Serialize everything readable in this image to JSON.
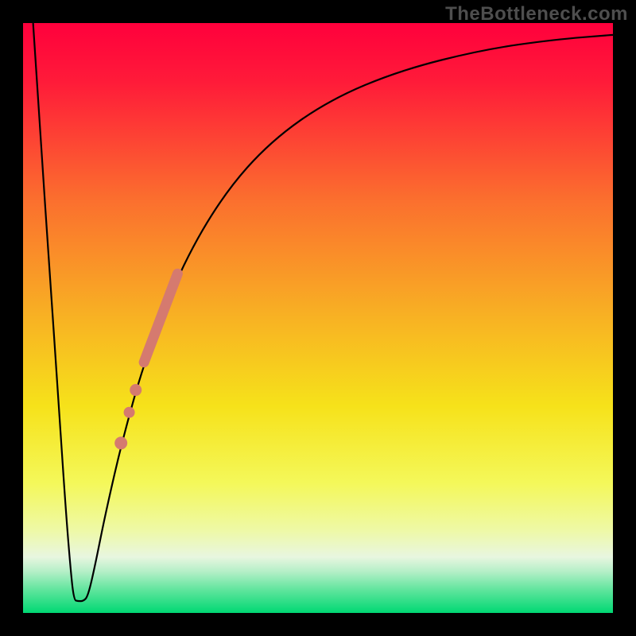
{
  "watermark": "TheBottleneck.com",
  "chart_data": {
    "type": "line",
    "title": "",
    "xlabel": "",
    "ylabel": "",
    "xlim": [
      0,
      1
    ],
    "ylim": [
      0,
      1
    ],
    "description": "Bottleneck-style V-curve over a vertical red→orange→yellow→green gradient. Left branch plunges from top-left to a narrow flat valley near x≈0.09, right branch rises steeply then asymptotically toward the top-right. A salmon highlight segment and three dots sit on the rising branch in the lower-middle region.",
    "gradient_stops": [
      {
        "offset": 0.0,
        "color": "#ff003c"
      },
      {
        "offset": 0.1,
        "color": "#ff1b39"
      },
      {
        "offset": 0.3,
        "color": "#fb6f2e"
      },
      {
        "offset": 0.5,
        "color": "#f8b223"
      },
      {
        "offset": 0.65,
        "color": "#f6e21a"
      },
      {
        "offset": 0.78,
        "color": "#f4f85a"
      },
      {
        "offset": 0.86,
        "color": "#eef9a6"
      },
      {
        "offset": 0.905,
        "color": "#e8f6e0"
      },
      {
        "offset": 0.93,
        "color": "#b4efc7"
      },
      {
        "offset": 0.96,
        "color": "#62e59e"
      },
      {
        "offset": 1.0,
        "color": "#00d873"
      }
    ],
    "series": [
      {
        "name": "bottleneck-curve",
        "points": [
          {
            "x": 0.017,
            "y": 1.0
          },
          {
            "x": 0.03,
            "y": 0.8
          },
          {
            "x": 0.045,
            "y": 0.58
          },
          {
            "x": 0.06,
            "y": 0.36
          },
          {
            "x": 0.072,
            "y": 0.18
          },
          {
            "x": 0.08,
            "y": 0.08
          },
          {
            "x": 0.086,
            "y": 0.022
          },
          {
            "x": 0.093,
            "y": 0.02
          },
          {
            "x": 0.102,
            "y": 0.02
          },
          {
            "x": 0.11,
            "y": 0.028
          },
          {
            "x": 0.122,
            "y": 0.08
          },
          {
            "x": 0.14,
            "y": 0.17
          },
          {
            "x": 0.17,
            "y": 0.3
          },
          {
            "x": 0.21,
            "y": 0.44
          },
          {
            "x": 0.27,
            "y": 0.59
          },
          {
            "x": 0.34,
            "y": 0.71
          },
          {
            "x": 0.42,
            "y": 0.8
          },
          {
            "x": 0.52,
            "y": 0.87
          },
          {
            "x": 0.64,
            "y": 0.92
          },
          {
            "x": 0.78,
            "y": 0.955
          },
          {
            "x": 0.9,
            "y": 0.972
          },
          {
            "x": 1.0,
            "y": 0.98
          }
        ]
      }
    ],
    "highlight": {
      "segment": {
        "x1": 0.205,
        "y1": 0.425,
        "x2": 0.262,
        "y2": 0.575
      },
      "dots": [
        {
          "x": 0.191,
          "y": 0.378,
          "r": 7.5
        },
        {
          "x": 0.18,
          "y": 0.34,
          "r": 7
        },
        {
          "x": 0.166,
          "y": 0.288,
          "r": 8
        }
      ]
    }
  }
}
